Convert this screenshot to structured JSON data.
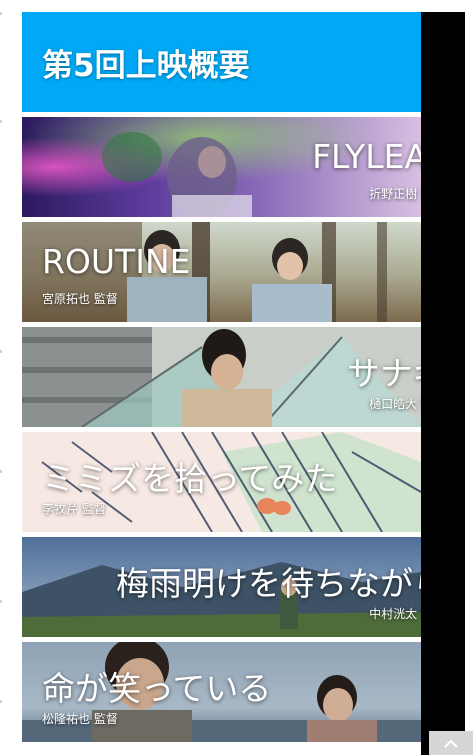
{
  "header": {
    "title": "第5回上映概要"
  },
  "films": [
    {
      "title": "FLYLEAF",
      "director": "折野正樹 監督",
      "align": "right"
    },
    {
      "title": "ROUTINE",
      "director": "宮原拓也 監督",
      "align": "left"
    },
    {
      "title": "サナギ",
      "director": "樋口皓大 監督",
      "align": "right"
    },
    {
      "title": "ミミズを拾ってみた",
      "director": "李牧芹 監督",
      "align": "left"
    },
    {
      "title": "梅雨明けを待ちながら",
      "director": "中村洸太 監督",
      "align": "right"
    },
    {
      "title": "命が笑っている",
      "director": "松隆祐也 監督",
      "align": "left"
    }
  ],
  "colors": {
    "header_bg": "#00a8f5",
    "side_strip": "#000000",
    "scroll_button": "#d6d6d6"
  },
  "icons": {
    "scroll_top": "chevron-up-icon"
  }
}
